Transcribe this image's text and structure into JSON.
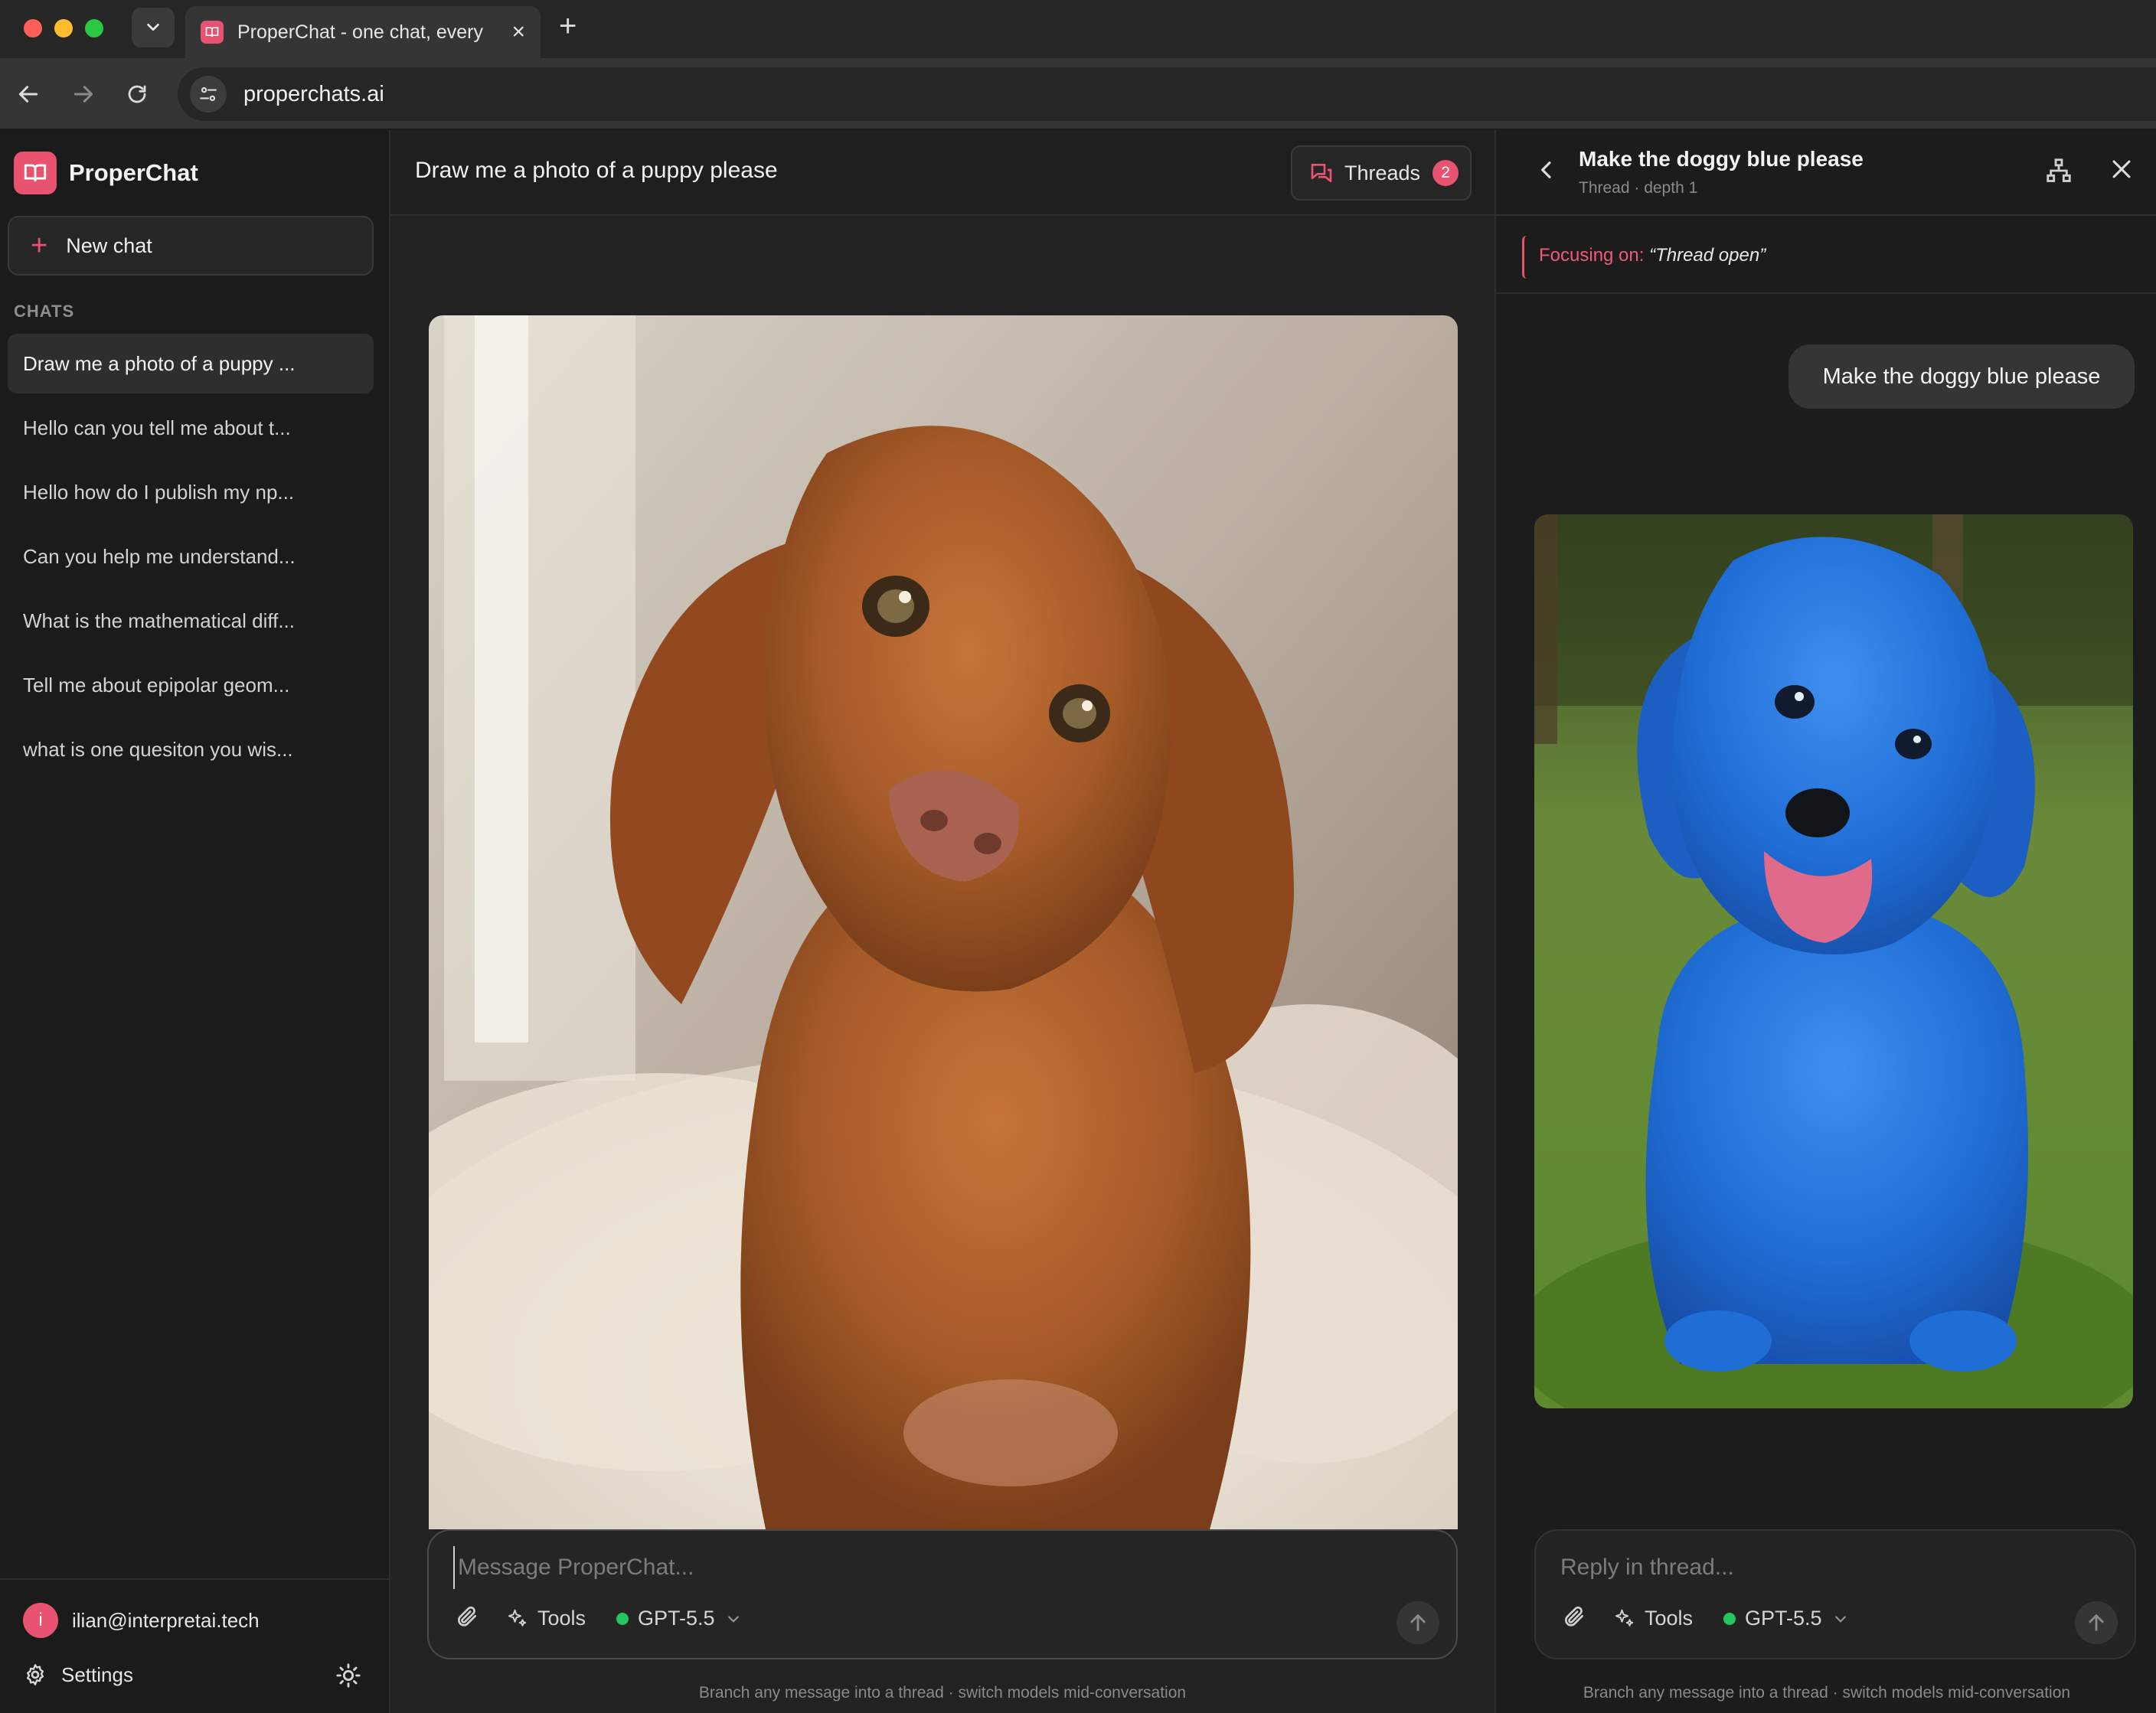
{
  "browser": {
    "tab_title": "ProperChat - one chat, every",
    "url": "properchats.ai"
  },
  "sidebar": {
    "brand": "ProperChat",
    "new_chat_label": "New chat",
    "chats_heading": "CHATS",
    "chats": [
      "Draw me a photo of a puppy ...",
      "Hello can you tell me about t...",
      "Hello how do I publish my np...",
      "Can you help me understand...",
      "What is the mathematical diff...",
      "Tell me about epipolar geom...",
      "what is one quesiton you wis..."
    ],
    "user_initial": "i",
    "user_email": "ilian@interpretai.tech",
    "settings_label": "Settings"
  },
  "main": {
    "title": "Draw me a photo of a puppy please",
    "threads_label": "Threads",
    "threads_count": "2",
    "composer_placeholder": "Message ProperChat...",
    "tools_label": "Tools",
    "model_label": "GPT-5.5",
    "footnote": "Branch any message into a thread · switch models mid-conversation"
  },
  "thread": {
    "title": "Make the doggy blue please",
    "subtitle": "Thread · depth 1",
    "focus_label": "Focusing on:",
    "focus_quote": "“Thread open”",
    "user_message": "Make the doggy blue please",
    "composer_placeholder": "Reply in thread...",
    "tools_label": "Tools",
    "model_label": "GPT-5.5",
    "footnote": "Branch any message into a thread · switch models mid-conversation"
  },
  "colors": {
    "accent": "#e8536f",
    "model_dot": "#22c55e"
  }
}
